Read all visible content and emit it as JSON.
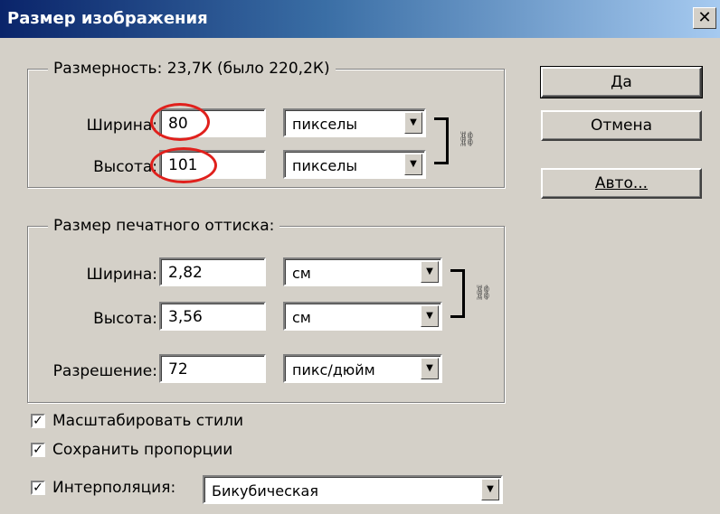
{
  "window": {
    "title": "Размер изображения",
    "close_glyph": "✕"
  },
  "dimensions": {
    "legend": "Размерность:  23,7К (было 220,2К)",
    "width": {
      "label": "Ширина:",
      "value": "80",
      "unit": "пикселы"
    },
    "height": {
      "label": "Высота:",
      "value": "101",
      "unit": "пикселы"
    }
  },
  "print_size": {
    "legend": "Размер печатного оттиска:",
    "width": {
      "label": "Ширина:",
      "value": "2,82",
      "unit": "см"
    },
    "height": {
      "label": "Высота:",
      "value": "3,56",
      "unit": "см"
    },
    "resolution": {
      "label": "Разрешение:",
      "value": "72",
      "unit": "пикс/дюйм"
    }
  },
  "buttons": {
    "ok": "Да",
    "cancel": "Отмена",
    "auto": "Авто..."
  },
  "options": {
    "scale_styles": {
      "label": "Масштабировать стили",
      "checked": true
    },
    "constrain_proportions": {
      "label": "Сохранить пропорции",
      "checked": true
    },
    "resample": {
      "label": "Интерполяция:",
      "checked": true,
      "method": "Бикубическая"
    }
  },
  "icons": {
    "chain": "chain-link-icon",
    "dropdown": "chevron-down-icon"
  },
  "colors": {
    "highlight_oval": "#e0201c",
    "titlebar": "#0a246a"
  }
}
